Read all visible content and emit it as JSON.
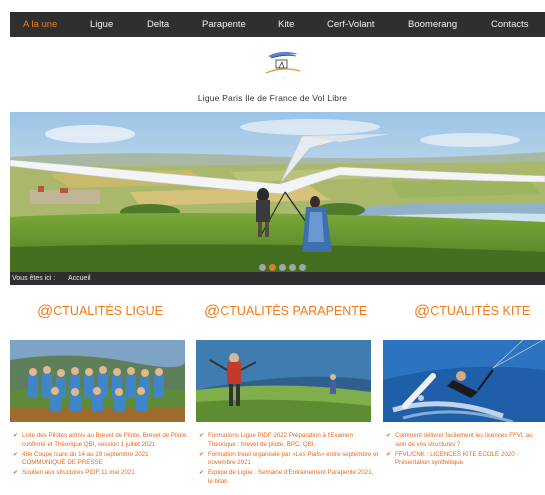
{
  "nav": {
    "items": [
      {
        "label": "A la une",
        "active": true
      },
      {
        "label": "Ligue",
        "active": false
      },
      {
        "label": "Delta",
        "active": false
      },
      {
        "label": "Parapente",
        "active": false
      },
      {
        "label": "Kite",
        "active": false
      },
      {
        "label": "Cerf-Volant",
        "active": false
      },
      {
        "label": "Boomerang",
        "active": false
      },
      {
        "label": "Contacts",
        "active": false
      }
    ]
  },
  "site": {
    "title": "Ligue Paris Ile de France de Vol Libre",
    "logo_icon": "kite-flyer-logo"
  },
  "hero": {
    "slide_count": 5,
    "active_slide": 1
  },
  "breadcrumb": {
    "prefix": "Vous êtes ici :",
    "current": "Accueil"
  },
  "sections": [
    {
      "title_at": "@",
      "title_rest": "CTUALITÉS LIGUE",
      "items": [
        "Liste des Pilotes admis au Brevet de Pilote, Brevet de Pilote confirmé et Théorique QBI, session 1 juillet 2021",
        "48e Coupe Icare du 14 au 19 septembre 2021 COMMUNIQUÉ DE PRESSE",
        "Soutien aux structures PIDF 11 mai 2021"
      ]
    },
    {
      "title_at": "@",
      "title_rest": "CTUALITÉS PARAPENTE",
      "items": [
        "Formations Ligue PIDF 2022 Préparation à l'Examen Théorique : brevet de pilote, BPC, QBI,",
        "Formation treuil organisée par «Les Piafs» entre septembre et novembre 2021",
        "Equipe de Ligue : Semaine d'Entraînement Parapente 2021, le bilan"
      ]
    },
    {
      "title_at": "@",
      "title_rest": "CTUALITÉS KITE",
      "items": [
        "Comment délivrer facilement les licences FFVL au sein de vos structures ?",
        "FFVL/CNK : LICENCES KITE ECOLE 2020 - Présentation synthétique"
      ]
    }
  ],
  "colors": {
    "accent": "#f07a1a",
    "nav_bg": "#2f2f2f"
  }
}
